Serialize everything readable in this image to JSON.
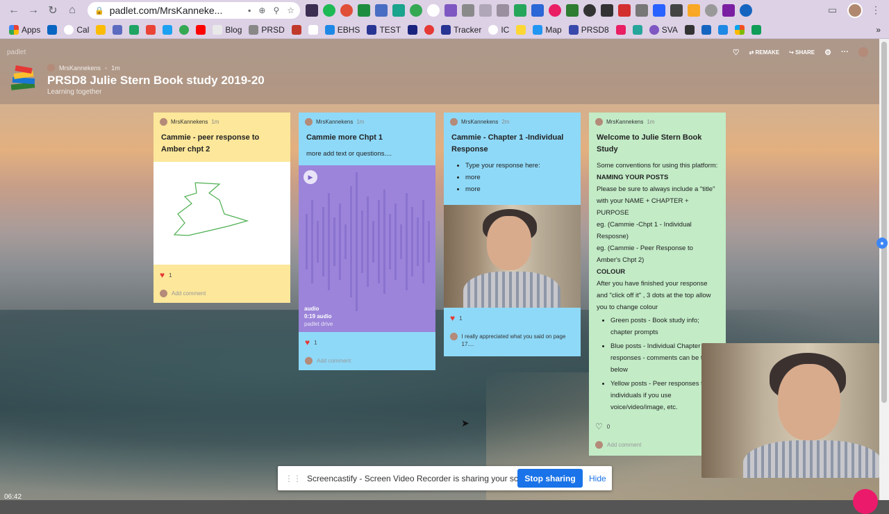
{
  "browser": {
    "url": "padlet.com/MrsKanneke...",
    "bookmarks": [
      "Apps",
      "Cal",
      "Blog",
      "PRSD",
      "EBHS",
      "TEST",
      "Tracker",
      "IC",
      "Map",
      "PRSD8",
      "SVA"
    ]
  },
  "padlet": {
    "brand": "padlet",
    "author": "MrsKannekens",
    "author_time": "1m",
    "title": "PRSD8 Julie Stern Book study 2019-20",
    "subtitle": "Learning together",
    "actions": {
      "remake": "REMAKE",
      "share": "SHARE"
    }
  },
  "cards": [
    {
      "author": "MrsKannekens",
      "time": "1m",
      "title": "Cammie - peer response to Amber chpt 2",
      "likes": "1",
      "comment_placeholder": "Add comment"
    },
    {
      "author": "MrsKannekens",
      "time": "1m",
      "title": "Cammie more Chpt 1",
      "body": "more add text or questions....",
      "audio_label": "audio",
      "audio_length": "0:19 audio",
      "audio_source": "padlet drive",
      "likes": "1",
      "comment_placeholder": "Add comment"
    },
    {
      "author": "MrsKannekens",
      "time": "2m",
      "title": "Cammie - Chapter 1 -Individual Response",
      "bullets": [
        "Type your response here:",
        "more",
        "more"
      ],
      "likes": "1",
      "comment": "I really appreciated what you said on page 17...."
    },
    {
      "author": "MrsKannekens",
      "time": "1m",
      "title": "Welcome to Julie Stern Book Study",
      "intro": "Some conventions for using this platform:",
      "h1": "NAMING YOUR POSTS",
      "p1": "Please be sure to always include a \"title\" with your NAME + CHAPTER + PURPOSE",
      "ex1": "eg. (Cammie -Chpt 1 - Individual Resposne)",
      "ex2": "eg. (Cammie - Peer Response to Amber's Chpt 2)",
      "h2": "COLOUR",
      "p2": "After you have finished your response and \"click off it\" , 3 dots at the top allow you to change colour",
      "bullets": [
        "Green posts - Book study info; chapter prompts",
        "Blue posts - Individual Chapter responses - comments can be typed below",
        "Yellow posts - Peer responses to individuals if you use voice/video/image, etc."
      ],
      "likes": "0",
      "comment_placeholder": "Add comment"
    }
  ],
  "share_bar": {
    "message": "Screencastify - Screen Video Recorder is sharing your screen.",
    "stop": "Stop sharing",
    "hide": "Hide"
  },
  "clock": "06:42"
}
